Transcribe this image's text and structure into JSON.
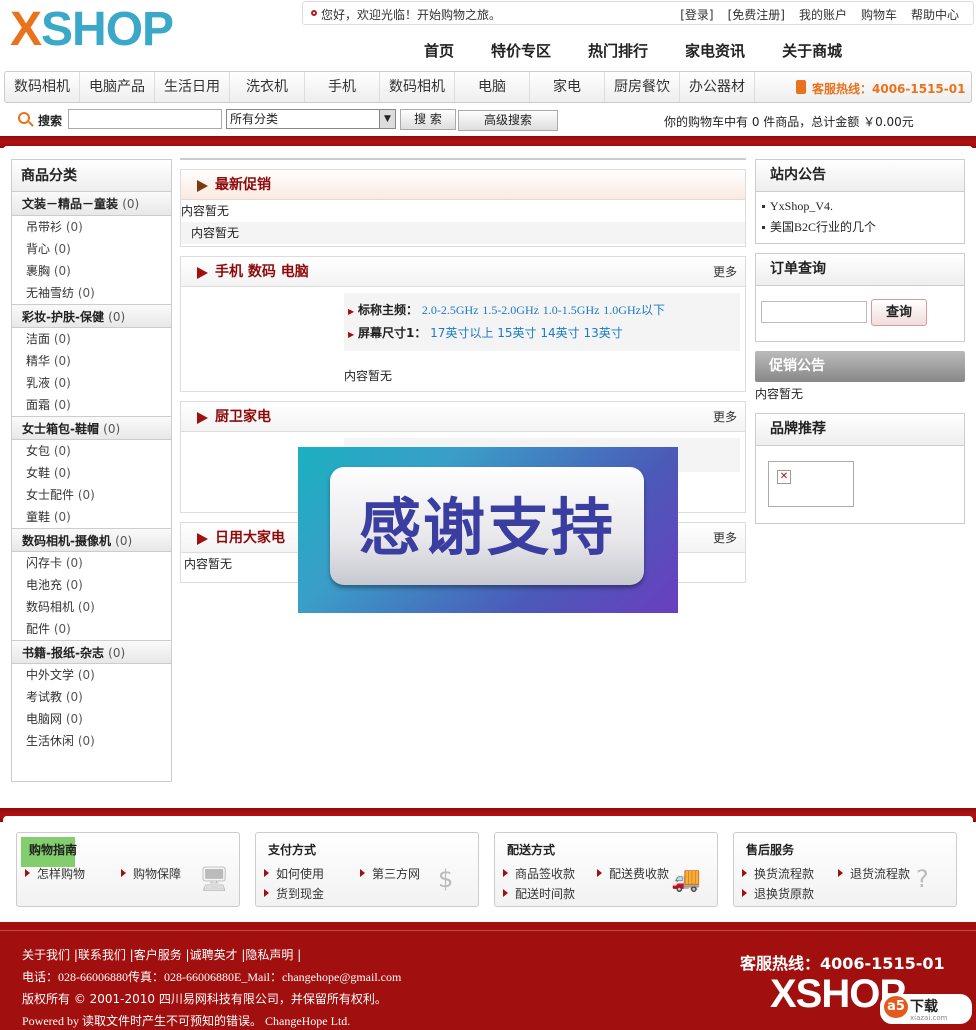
{
  "header": {
    "logo": "XSHOP",
    "welcome": "您好，欢迎光临！开始购物之旅。",
    "top_links": [
      "[登录]",
      "[免费注册]",
      "我的账户",
      "购物车",
      "帮助中心"
    ],
    "main_nav": [
      "首页",
      "特价专区",
      "热门排行",
      "家电资讯",
      "关于商城"
    ],
    "categories": [
      "数码相机",
      "电脑产品",
      "生活日用",
      "洗衣机",
      "手机",
      "数码相机",
      "电脑",
      "家电",
      "厨房餐饮",
      "办公器材"
    ],
    "hotline": "客服热线：4006-1515-01"
  },
  "search": {
    "label": "搜索",
    "input_value": "",
    "select_value": "所有分类",
    "search_button": "搜 索",
    "advanced_button": "高级搜索",
    "cart_info": "你的购物车中有 0 件商品，总计金额 ￥0.00元"
  },
  "left": {
    "title": "商品分类",
    "groups": [
      {
        "title": "文装－精品－童装",
        "count": "(0)",
        "items": [
          [
            "吊带衫",
            "(0)"
          ],
          [
            "背心",
            "(0)"
          ],
          [
            "裹胸",
            "(0)"
          ],
          [
            "无袖雪纺",
            "(0)"
          ]
        ]
      },
      {
        "title": "彩妆-护肤-保健",
        "count": "(0)",
        "items": [
          [
            "洁面",
            "(0)"
          ],
          [
            "精华",
            "(0)"
          ],
          [
            "乳液",
            "(0)"
          ],
          [
            "面霜",
            "(0)"
          ]
        ]
      },
      {
        "title": "女士箱包-鞋帽",
        "count": "(0)",
        "items": [
          [
            "女包",
            "(0)"
          ],
          [
            "女鞋",
            "(0)"
          ],
          [
            "女士配件",
            "(0)"
          ],
          [
            "童鞋",
            "(0)"
          ]
        ]
      },
      {
        "title": "数码相机-摄像机",
        "count": "(0)",
        "items": [
          [
            "闪存卡",
            "(0)"
          ],
          [
            "电池充",
            "(0)"
          ],
          [
            "数码相机",
            "(0)"
          ],
          [
            "配件",
            "(0)"
          ]
        ]
      },
      {
        "title": "书籍-报纸-杂志",
        "count": "(0)",
        "items": [
          [
            "中外文学",
            "(0)"
          ],
          [
            "考试教",
            "(0)"
          ],
          [
            "电脑网",
            "(0)"
          ],
          [
            "生活休闲",
            "(0)"
          ]
        ]
      }
    ]
  },
  "center": {
    "promo": {
      "title": "最新促销",
      "line1": "内容暂无",
      "line2": "内容暂无"
    },
    "phones": {
      "title": "手机 数码 电脑",
      "more": "更多",
      "freq_label": "标称主频：",
      "freqs": [
        "2.0-2.5GHz",
        "1.5-2.0GHz",
        "1.0-1.5GHz",
        "1.0GHz以下"
      ],
      "size_label": "屏幕尺寸1：",
      "sizes": [
        "17英寸以上",
        "15英寸",
        "14英寸",
        "13英寸"
      ],
      "empty": "内容暂无"
    },
    "kitchen": {
      "title": "厨卫家电",
      "more": "更多"
    },
    "appliance": {
      "title": "日用大家电",
      "more": "更多",
      "empty": "内容暂无"
    }
  },
  "right": {
    "notice_title": "站内公告",
    "notices": [
      "YxShop_V4.",
      "美国B2C行业的几个"
    ],
    "order_title": "订单查询",
    "order_input": "",
    "order_button": "查询",
    "sale_title": "促销公告",
    "sale_empty": "内容暂无",
    "brand_title": "品牌推荐"
  },
  "overlay": {
    "text": "感谢支持"
  },
  "info": [
    {
      "title": "购物指南",
      "items": [
        "怎样购物",
        "购物保障"
      ]
    },
    {
      "title": "支付方式",
      "items": [
        "如何使用",
        "第三方网",
        "货到现金"
      ]
    },
    {
      "title": "配送方式",
      "items": [
        "商品签收款",
        "配送费收款",
        "配送时间款"
      ]
    },
    {
      "title": "售后服务",
      "items": [
        "换货流程款",
        "退货流程款",
        "退换货原款"
      ]
    }
  ],
  "footer": {
    "links": "关于我们 |联系我们 |客户服务 |诚聘英才 |隐私声明 |",
    "contact": "电话：028-66006880传真：028-66006880E_Mail：changehope@gmail.com",
    "copyright": "版权所有 © 2001-2010 四川易网科技有限公司，并保留所有权利。",
    "powered": "Powered by 读取文件时产生不可预知的错误。 ChangeHope Ltd.",
    "hotline": "客服热线：4006-1515-01",
    "logo": "XSHOP",
    "watermark": "下载",
    "watermark_sub": "xiazai.com"
  },
  "colors": {
    "brand_red": "#a10f0f",
    "accent_orange": "#e8731c",
    "logo_blue": "#3aa8c8",
    "link_blue": "#1a7ac8"
  }
}
